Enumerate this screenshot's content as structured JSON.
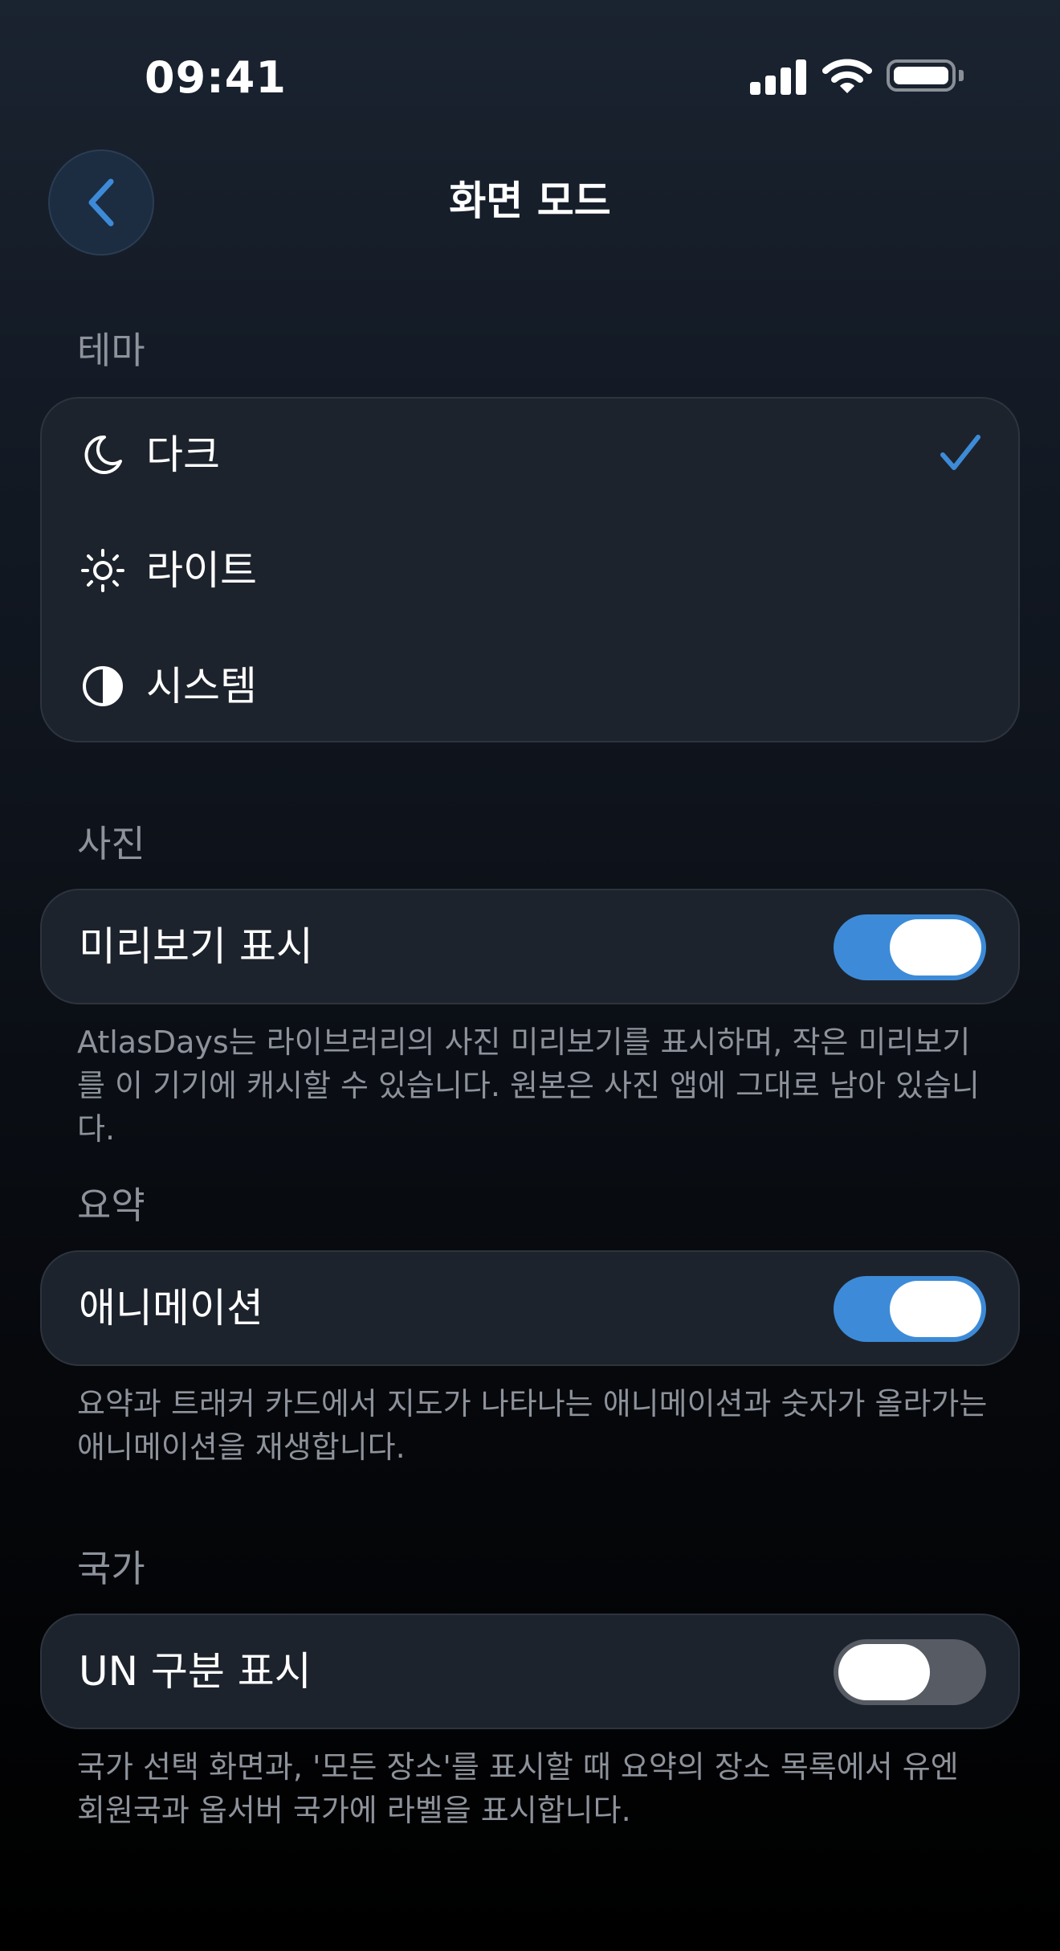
{
  "status_bar": {
    "time": "09:41"
  },
  "header": {
    "back_icon": "chevron-left-icon",
    "title": "화면 모드"
  },
  "colors": {
    "accent": "#3d8bd8",
    "card": "#1d232c",
    "secondary_text": "#8d929b"
  },
  "theme": {
    "label": "테마",
    "options": [
      {
        "label": "다크",
        "icon": "moon-icon",
        "selected": true
      },
      {
        "label": "라이트",
        "icon": "sun-icon",
        "selected": false
      },
      {
        "label": "시스템",
        "icon": "half-circle-icon",
        "selected": false
      }
    ]
  },
  "photos": {
    "label": "사진",
    "toggle_label": "미리보기 표시",
    "toggle_on": true,
    "description": "AtlasDays는 라이브러리의 사진 미리보기를 표시하며, 작은 미리보기를 이 기기에 캐시할 수 있습니다. 원본은 사진 앱에 그대로 남아 있습니다."
  },
  "summary": {
    "label": "요약",
    "toggle_label": "애니메이션",
    "toggle_on": true,
    "description": "요약과 트래커 카드에서 지도가 나타나는 애니메이션과 숫자가 올라가는 애니메이션을 재생합니다."
  },
  "country": {
    "label": "국가",
    "toggle_label": "UN 구분 표시",
    "toggle_on": false,
    "description": "국가 선택 화면과, '모든 장소'를 표시할 때 요약의 장소 목록에서 유엔 회원국과 옵서버 국가에 라벨을 표시합니다."
  }
}
